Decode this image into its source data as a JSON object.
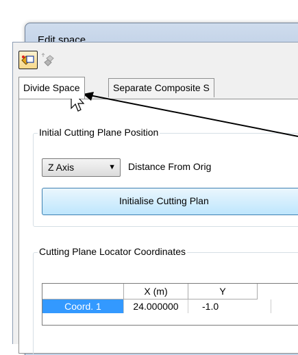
{
  "window": {
    "title": "Edit space"
  },
  "toolbar": {
    "divide_icon": "divide-space-icon",
    "separate_icon": "separate-objects-icon"
  },
  "tabs": [
    {
      "label": "Divide Space",
      "active": true
    },
    {
      "label": "Separate Composite S",
      "active": false
    }
  ],
  "initial_group": {
    "label": "Initial Cutting Plane Position",
    "axis_select": {
      "value": "Z Axis"
    },
    "distance_label": "Distance From Orig",
    "init_button": "Initialise Cutting Plan"
  },
  "locator_group": {
    "label": "Cutting Plane Locator Coordinates",
    "columns": [
      "",
      "X (m)",
      "Y"
    ],
    "rows": [
      {
        "label": "Coord. 1",
        "x": "24.000000",
        "y": "-1.0"
      }
    ]
  },
  "colors": {
    "window_frame": "#bfd0e6",
    "selection": "#3399ff",
    "button_hover": "#bee6fd"
  }
}
